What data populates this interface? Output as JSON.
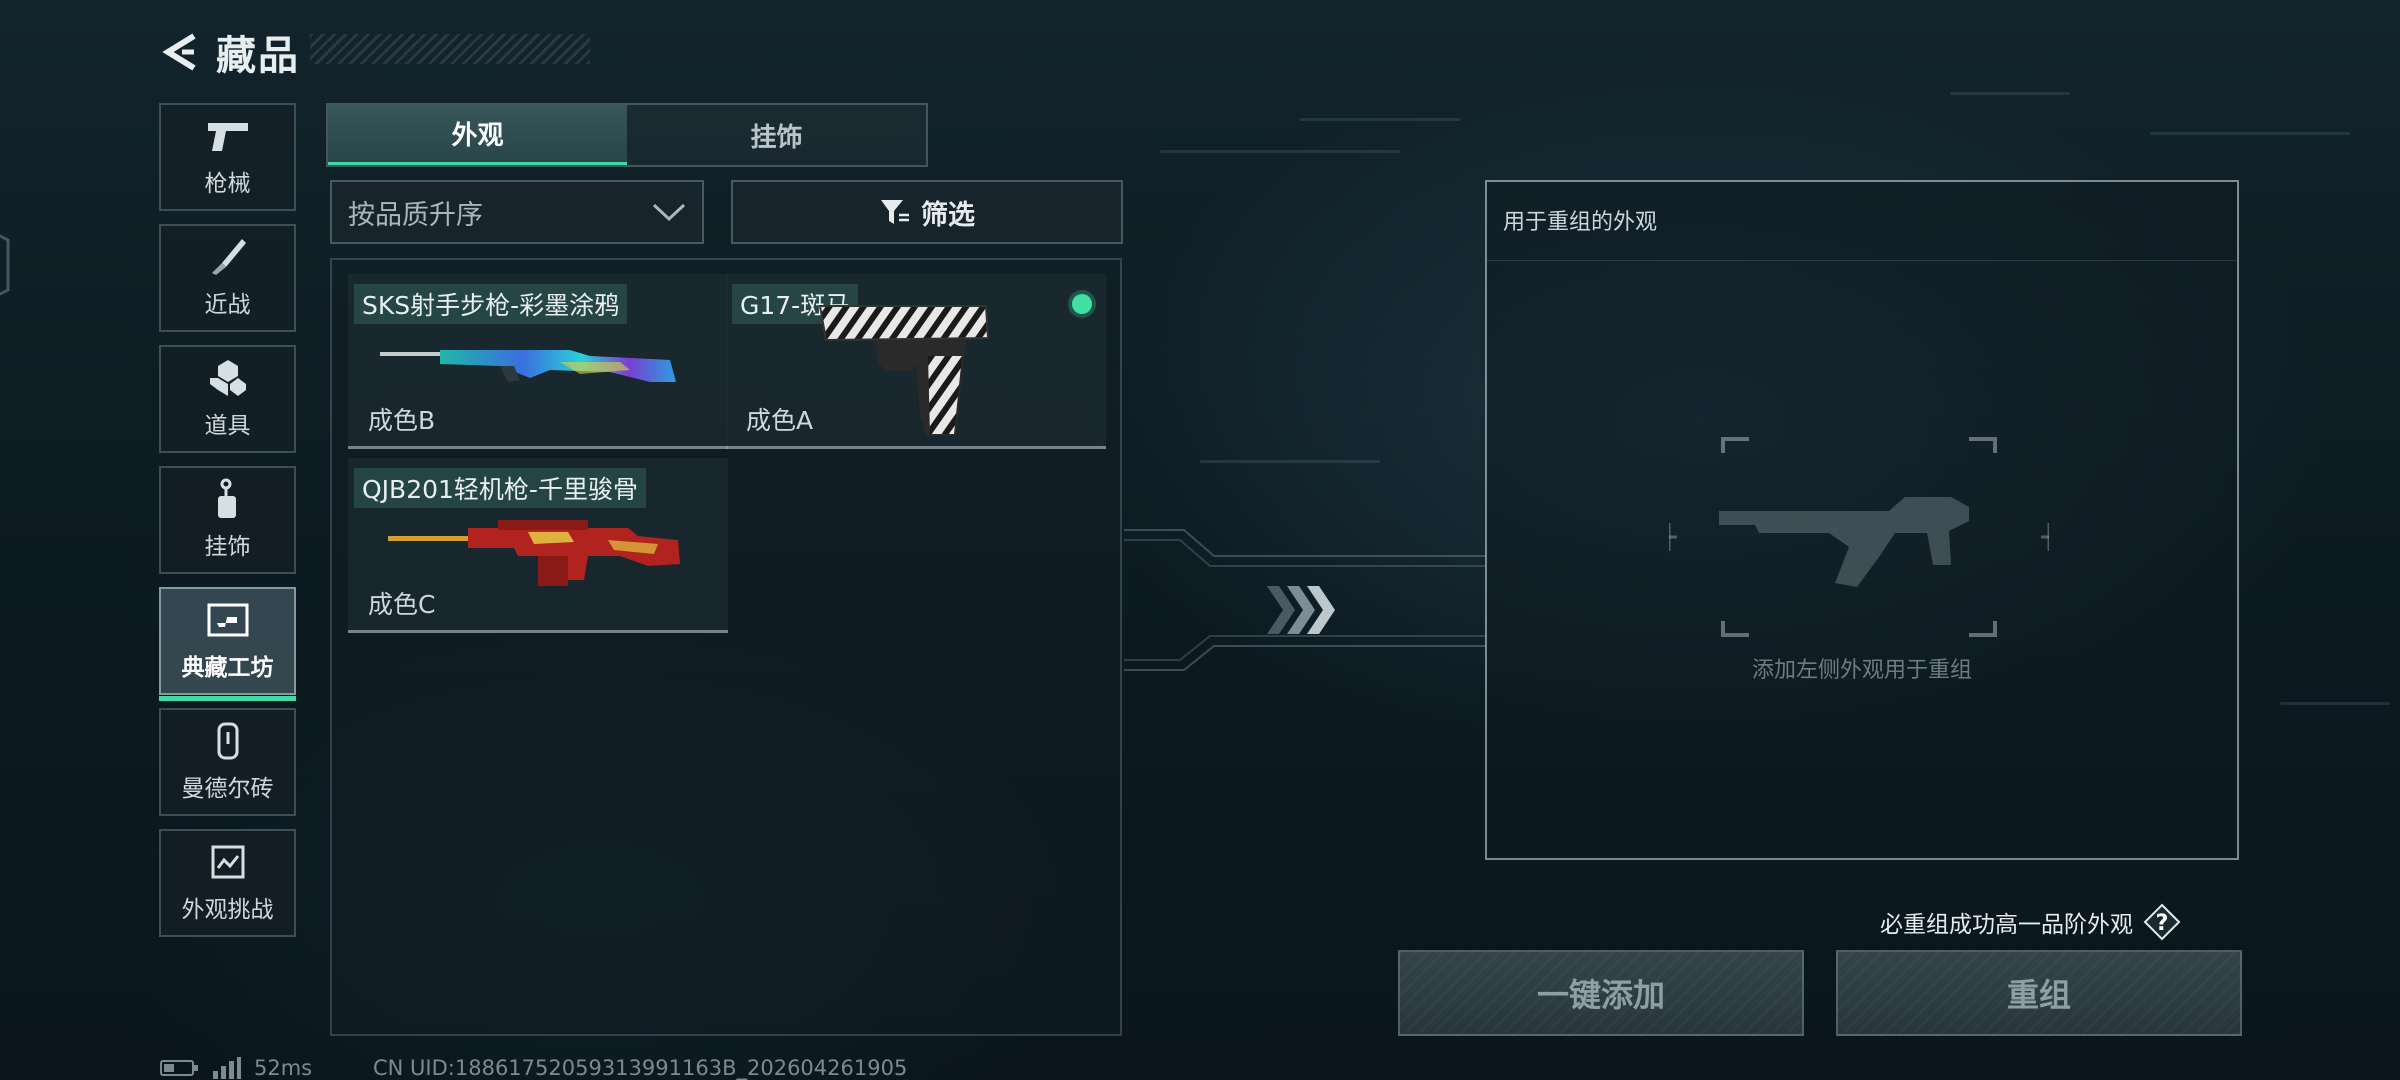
{
  "header": {
    "title": "藏品"
  },
  "sidebar": {
    "items": [
      {
        "label": "枪械",
        "icon": "pistol-icon",
        "active": false
      },
      {
        "label": "近战",
        "icon": "knife-icon",
        "active": false
      },
      {
        "label": "道具",
        "icon": "grenade-icon",
        "active": false
      },
      {
        "label": "挂饰",
        "icon": "charm-icon",
        "active": false
      },
      {
        "label": "典藏工坊",
        "icon": "workshop-icon",
        "active": true
      },
      {
        "label": "曼德尔砖",
        "icon": "brick-icon",
        "active": false
      },
      {
        "label": "外观挑战",
        "icon": "challenge-icon",
        "active": false
      }
    ]
  },
  "tabs": [
    {
      "label": "外观",
      "active": true
    },
    {
      "label": "挂饰",
      "active": false
    }
  ],
  "sort": {
    "label": "按品质升序"
  },
  "filter": {
    "label": "筛选"
  },
  "skins": [
    {
      "name": "SKS射手步枪-彩墨涂鸦",
      "grade": "成色B",
      "equipped": false
    },
    {
      "name": "G17-斑马",
      "grade": "成色A",
      "equipped": true
    },
    {
      "name": "QJB201轻机枪-千里骏骨",
      "grade": "成色C",
      "equipped": false
    }
  ],
  "recompose": {
    "title": "用于重组的外观",
    "placeholder": "添加左侧外观用于重组"
  },
  "hint": {
    "text": "必重组成功高一品阶外观",
    "help": "?"
  },
  "buttons": {
    "add_all": "一键添加",
    "recompose": "重组"
  },
  "status": {
    "ping": "52ms",
    "uid": "CN UID:18861752059313991163B_202604261905"
  },
  "colors": {
    "accent": "#3fd9a4",
    "equipped": "#3fe0a0"
  }
}
